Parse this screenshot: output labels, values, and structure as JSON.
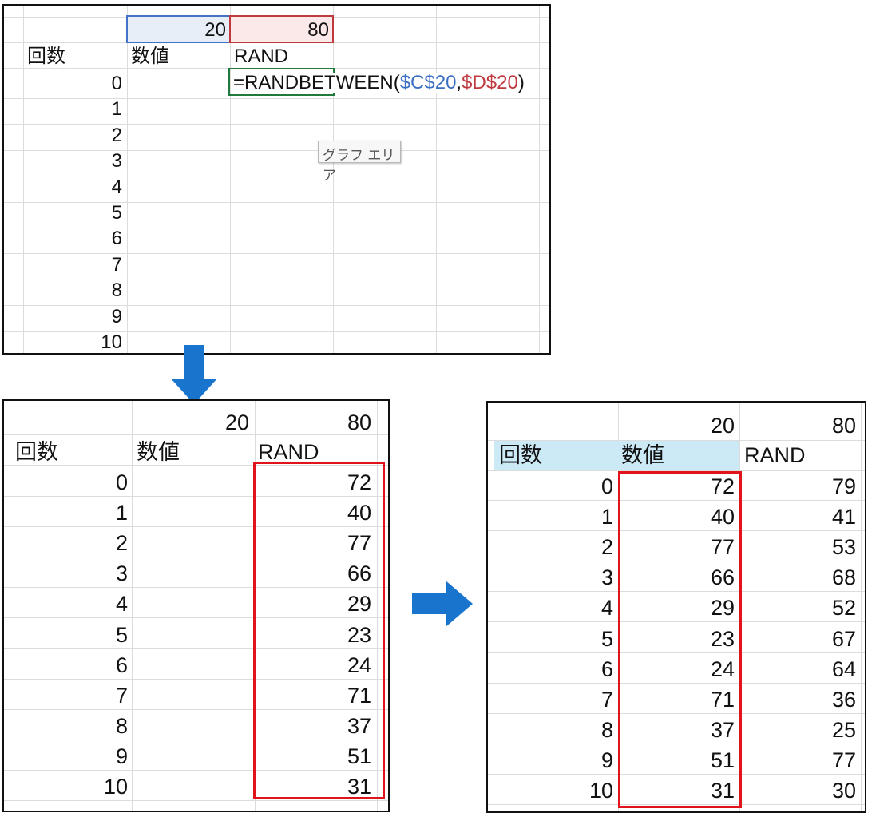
{
  "panel1": {
    "min_value": "20",
    "max_value": "80",
    "headers": [
      "回数",
      "数値",
      "RAND"
    ],
    "formula": {
      "prefix": "=RANDBETWEEN(",
      "ref_min": "$C$20",
      "sep": ",",
      "ref_max": "$D$20",
      "suffix": ")"
    },
    "tooltip": "グラフ エリア",
    "rows": [
      "0",
      "1",
      "2",
      "3",
      "4",
      "5",
      "6",
      "7",
      "8",
      "9",
      "10"
    ]
  },
  "panel2": {
    "min_value": "20",
    "max_value": "80",
    "headers": [
      "回数",
      "数値",
      "RAND"
    ],
    "rows": [
      {
        "n": "0",
        "rand": "72"
      },
      {
        "n": "1",
        "rand": "40"
      },
      {
        "n": "2",
        "rand": "77"
      },
      {
        "n": "3",
        "rand": "66"
      },
      {
        "n": "4",
        "rand": "29"
      },
      {
        "n": "5",
        "rand": "23"
      },
      {
        "n": "6",
        "rand": "24"
      },
      {
        "n": "7",
        "rand": "71"
      },
      {
        "n": "8",
        "rand": "37"
      },
      {
        "n": "9",
        "rand": "51"
      },
      {
        "n": "10",
        "rand": "31"
      }
    ]
  },
  "panel3": {
    "min_value": "20",
    "max_value": "80",
    "headers": [
      "回数",
      "数値",
      "RAND"
    ],
    "rows": [
      {
        "n": "0",
        "value": "72",
        "rand": "79"
      },
      {
        "n": "1",
        "value": "40",
        "rand": "41"
      },
      {
        "n": "2",
        "value": "77",
        "rand": "53"
      },
      {
        "n": "3",
        "value": "66",
        "rand": "68"
      },
      {
        "n": "4",
        "value": "29",
        "rand": "52"
      },
      {
        "n": "5",
        "value": "23",
        "rand": "67"
      },
      {
        "n": "6",
        "value": "24",
        "rand": "64"
      },
      {
        "n": "7",
        "value": "71",
        "rand": "36"
      },
      {
        "n": "8",
        "value": "37",
        "rand": "25"
      },
      {
        "n": "9",
        "value": "51",
        "rand": "77"
      },
      {
        "n": "10",
        "value": "31",
        "rand": "30"
      }
    ]
  },
  "colors": {
    "arrow": "#1874cd",
    "highlight_red": "#e0141c",
    "header_fill": "#cce9f6",
    "min_cell_fill": "#e8eef8",
    "max_cell_fill": "#fbe8e8",
    "selected_border": "#1f7a3c"
  }
}
